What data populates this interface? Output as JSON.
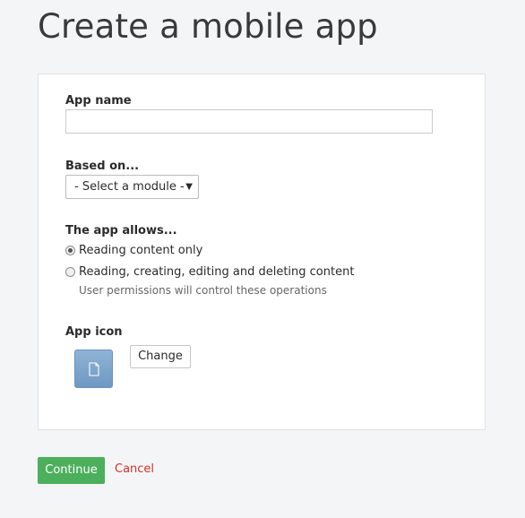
{
  "page": {
    "title": "Create a mobile app"
  },
  "form": {
    "app_name_label": "App name",
    "app_name_value": "",
    "based_on_label": "Based on...",
    "module_select_value": "- Select a module -",
    "allows_label": "The app allows...",
    "options": [
      {
        "label": "Reading content only",
        "checked": true
      },
      {
        "label": "Reading, creating, editing and deleting content",
        "checked": false
      }
    ],
    "permissions_note": "User permissions will control these operations",
    "app_icon_label": "App icon",
    "change_label": "Change"
  },
  "actions": {
    "continue_label": "Continue",
    "cancel_label": "Cancel"
  },
  "colors": {
    "primary": "#4caf5c",
    "cancel": "#d9302a",
    "icon_bg": "#7aa3cc"
  },
  "icons": {
    "app_icon": "document-icon"
  }
}
